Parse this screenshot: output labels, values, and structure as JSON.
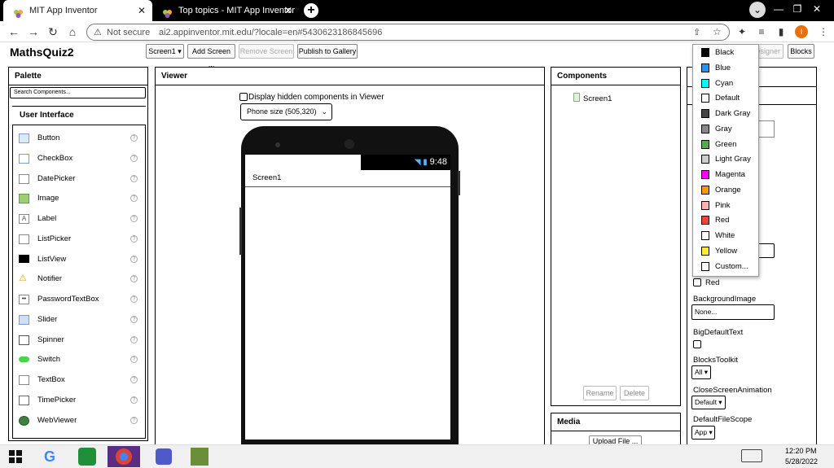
{
  "browser": {
    "tabs": [
      {
        "title": "MIT App Inventor",
        "close": "✕"
      },
      {
        "title": "Top topics - MIT App Inventor Co",
        "close": "✕"
      }
    ],
    "new_tab": "+",
    "window_controls": [
      "⌄",
      "—",
      "❐",
      "✕"
    ],
    "address": {
      "security": "Not secure",
      "url": "ai2.appinventor.mit.edu/?locale=en#5430623186845696"
    },
    "profile_initial": "I"
  },
  "toolbar": {
    "app_name": "MathsQuiz2",
    "screen_btn": "Screen1 ▾",
    "add_screen": "Add Screen ...",
    "remove_screen": "Remove Screen",
    "publish": "Publish to Gallery",
    "designer": "Designer",
    "blocks": "Blocks"
  },
  "palette": {
    "title": "Palette",
    "search_placeholder": "Search Components...",
    "group": "User Interface",
    "help": "?",
    "items": [
      "Button",
      "CheckBox",
      "DatePicker",
      "Image",
      "Label",
      "ListPicker",
      "ListView",
      "Notifier",
      "PasswordTextBox",
      "Slider",
      "Spinner",
      "Switch",
      "TextBox",
      "TimePicker",
      "WebViewer"
    ]
  },
  "viewer": {
    "title": "Viewer",
    "hidden_label": "Display hidden components in Viewer",
    "size_option": "Phone size (505,320)",
    "status_time": "9:48",
    "screen_title": "Screen1"
  },
  "components": {
    "title": "Components",
    "tree_root": "Screen1",
    "rename": "Rename",
    "delete": "Delete"
  },
  "media": {
    "title": "Media",
    "upload": "Upload File ..."
  },
  "properties": {
    "red_label": "Red",
    "bg_image_label": "BackgroundImage",
    "bg_image_value": "None...",
    "big_text_label": "BigDefaultText",
    "blocks_toolkit_label": "BlocksToolkit",
    "blocks_toolkit_value": "All ▾",
    "close_anim_label": "CloseScreenAnimation",
    "close_anim_value": "Default ▾",
    "file_scope_label": "DefaultFileScope",
    "file_scope_value": "App ▾"
  },
  "color_menu": [
    "Black",
    "Blue",
    "Cyan",
    "Default",
    "Dark Gray",
    "Gray",
    "Green",
    "Light Gray",
    "Magenta",
    "Orange",
    "Pink",
    "Red",
    "White",
    "Yellow",
    "Custom..."
  ],
  "taskbar": {
    "time": "12:20 PM",
    "date": "5/28/2022"
  }
}
